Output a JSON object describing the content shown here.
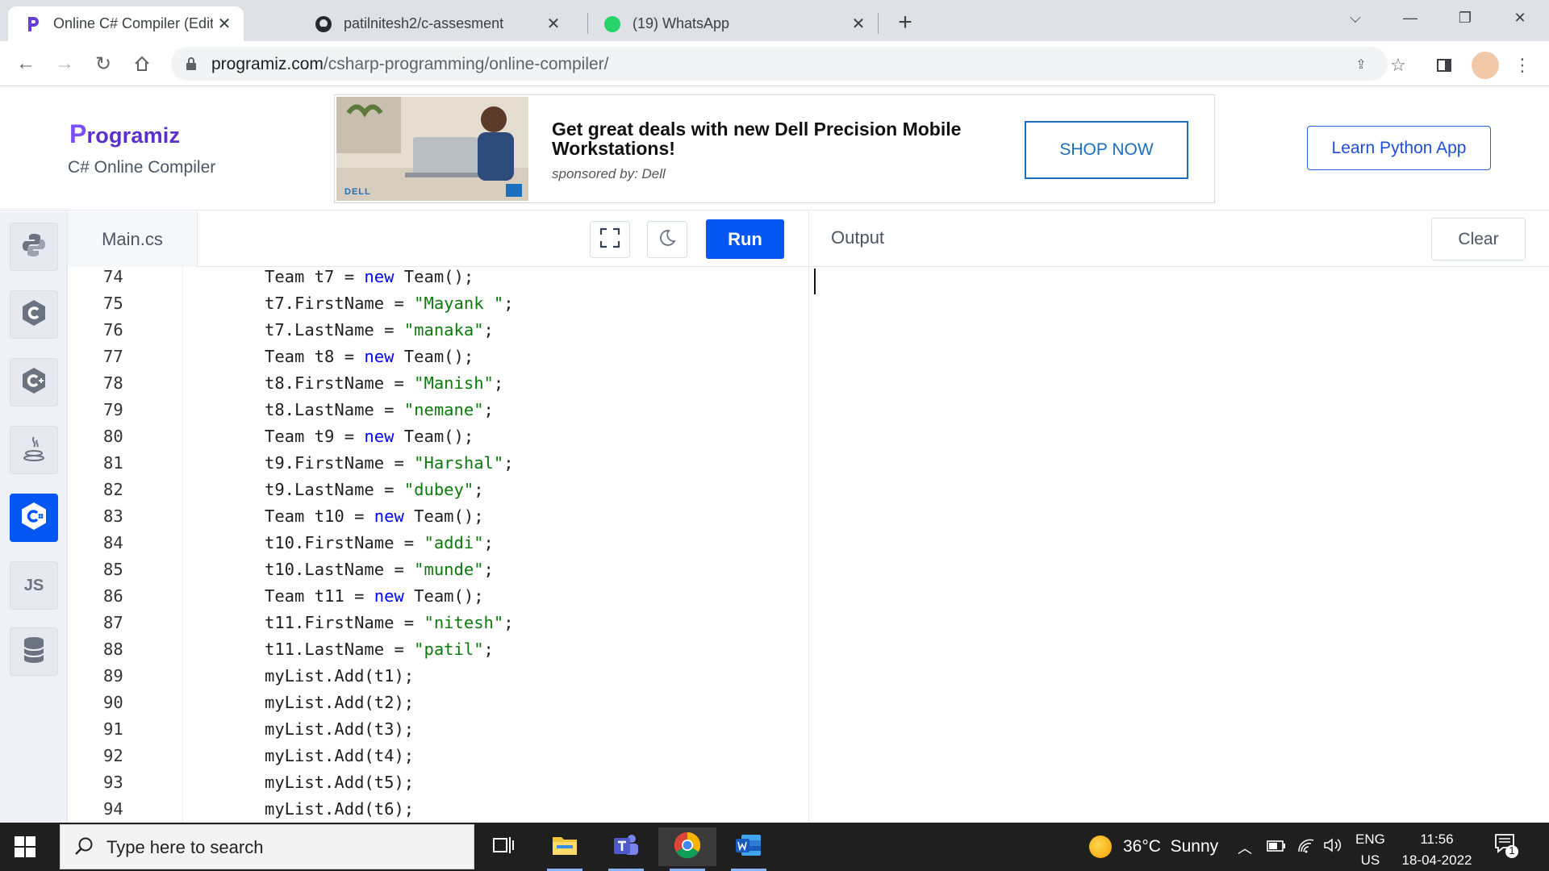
{
  "browser": {
    "tabs": [
      {
        "title": "Online C# Compiler (Editor)",
        "icon": "programiz-icon",
        "active": true
      },
      {
        "title": "patilnitesh2/c-assesment",
        "icon": "github-icon",
        "active": false
      },
      {
        "title": "(19) WhatsApp",
        "icon": "whatsapp-icon",
        "badge": "19",
        "active": false
      }
    ],
    "url_host": "programiz.com",
    "url_path": "/csharp-programming/online-compiler/"
  },
  "header": {
    "logo_initial": "P",
    "logo_rest": "rogramiz",
    "subtitle": "C# Online Compiler",
    "learn_button": "Learn Python App",
    "ad": {
      "headline": "Get great deals with new Dell Precision Mobile Workstations!",
      "sponsor": "sponsored by: Dell",
      "cta": "SHOP NOW",
      "brand": "DELL"
    }
  },
  "rail": {
    "items": [
      {
        "icon": "python-icon"
      },
      {
        "icon": "c-icon"
      },
      {
        "icon": "cpp-icon"
      },
      {
        "icon": "java-icon"
      },
      {
        "icon": "csharp-icon",
        "active": true
      },
      {
        "icon": "js-icon",
        "label": "JS"
      },
      {
        "icon": "database-icon"
      }
    ]
  },
  "editor": {
    "filename": "Main.cs",
    "run_label": "Run",
    "lines": [
      {
        "n": "74",
        "parts": [
          [
            "t",
            "Team t7 = "
          ],
          [
            "k",
            "new"
          ],
          [
            "t",
            " Team();"
          ]
        ]
      },
      {
        "n": "75",
        "parts": [
          [
            "t",
            "t7.FirstName = "
          ],
          [
            "s",
            "\"Mayank \""
          ],
          [
            "t",
            ";"
          ]
        ]
      },
      {
        "n": "76",
        "parts": [
          [
            "t",
            "t7.LastName = "
          ],
          [
            "s",
            "\"manaka\""
          ],
          [
            "t",
            ";"
          ]
        ]
      },
      {
        "n": "77",
        "parts": [
          [
            "t",
            "Team t8 = "
          ],
          [
            "k",
            "new"
          ],
          [
            "t",
            " Team();"
          ]
        ]
      },
      {
        "n": "78",
        "parts": [
          [
            "t",
            "t8.FirstName = "
          ],
          [
            "s",
            "\"Manish\""
          ],
          [
            "t",
            ";"
          ]
        ]
      },
      {
        "n": "79",
        "parts": [
          [
            "t",
            "t8.LastName = "
          ],
          [
            "s",
            "\"nemane\""
          ],
          [
            "t",
            ";"
          ]
        ]
      },
      {
        "n": "80",
        "parts": [
          [
            "t",
            "Team t9 = "
          ],
          [
            "k",
            "new"
          ],
          [
            "t",
            " Team();"
          ]
        ]
      },
      {
        "n": "81",
        "parts": [
          [
            "t",
            "t9.FirstName = "
          ],
          [
            "s",
            "\"Harshal\""
          ],
          [
            "t",
            ";"
          ]
        ]
      },
      {
        "n": "82",
        "parts": [
          [
            "t",
            "t9.LastName = "
          ],
          [
            "s",
            "\"dubey\""
          ],
          [
            "t",
            ";"
          ]
        ]
      },
      {
        "n": "83",
        "parts": [
          [
            "t",
            "Team t10 = "
          ],
          [
            "k",
            "new"
          ],
          [
            "t",
            " Team();"
          ]
        ]
      },
      {
        "n": "84",
        "parts": [
          [
            "t",
            "t10.FirstName = "
          ],
          [
            "s",
            "\"addi\""
          ],
          [
            "t",
            ";"
          ]
        ]
      },
      {
        "n": "85",
        "parts": [
          [
            "t",
            "t10.LastName = "
          ],
          [
            "s",
            "\"munde\""
          ],
          [
            "t",
            ";"
          ]
        ]
      },
      {
        "n": "86",
        "parts": [
          [
            "t",
            "Team t11 = "
          ],
          [
            "k",
            "new"
          ],
          [
            "t",
            " Team();"
          ]
        ]
      },
      {
        "n": "87",
        "parts": [
          [
            "t",
            "t11.FirstName = "
          ],
          [
            "s",
            "\"nitesh\""
          ],
          [
            "t",
            ";"
          ]
        ]
      },
      {
        "n": "88",
        "parts": [
          [
            "t",
            "t11.LastName = "
          ],
          [
            "s",
            "\"patil\""
          ],
          [
            "t",
            ";"
          ]
        ]
      },
      {
        "n": "89",
        "parts": [
          [
            "t",
            "myList.Add(t1);"
          ]
        ]
      },
      {
        "n": "90",
        "parts": [
          [
            "t",
            "myList.Add(t2);"
          ]
        ]
      },
      {
        "n": "91",
        "parts": [
          [
            "t",
            "myList.Add(t3);"
          ]
        ]
      },
      {
        "n": "92",
        "parts": [
          [
            "t",
            "myList.Add(t4);"
          ]
        ]
      },
      {
        "n": "93",
        "parts": [
          [
            "t",
            "myList.Add(t5);"
          ]
        ]
      },
      {
        "n": "94",
        "parts": [
          [
            "t",
            "myList.Add(t6);"
          ]
        ]
      }
    ]
  },
  "output": {
    "title": "Output",
    "clear_label": "Clear",
    "content": ""
  },
  "taskbar": {
    "search_placeholder": "Type here to search",
    "weather": "36°C  Sunny",
    "lang_top": "ENG",
    "lang_bottom": "US",
    "time": "11:56",
    "date": "18-04-2022",
    "notification_count": "1"
  },
  "colors": {
    "brand_purple": "#5b2fc9",
    "run_blue": "#0556f3",
    "keyword": "#0000ff",
    "string": "#0a7a0a"
  }
}
